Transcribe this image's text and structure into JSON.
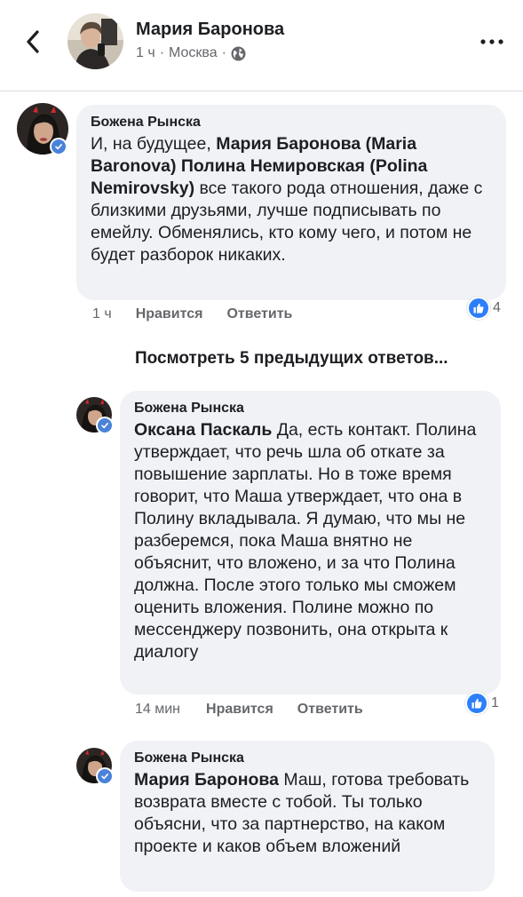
{
  "header": {
    "name": "Мария Баронова",
    "time": "1 ч",
    "separator": "·",
    "location": "Москва",
    "audience_icon": "globe-icon"
  },
  "comments": [
    {
      "author": "Божена Рынска",
      "segments": [
        {
          "t": "И, на будущее, ",
          "b": false
        },
        {
          "t": "Мария Баронова (Maria Baronova)",
          "b": true
        },
        {
          "t": " ",
          "b": false
        },
        {
          "t": "Полина Немировская (Polina Nemirovsky)",
          "b": true
        },
        {
          "t": " все такого рода отношения, даже с близкими друзьями, лучше подписывать по емейлу. Обменялись, кто кому чего, и потом не будет разборок никаких.",
          "b": false
        }
      ],
      "time": "1 ч",
      "like_label": "Нравится",
      "reply_label": "Ответить",
      "reaction_count": "4"
    },
    {
      "author": "Божена Рынска",
      "segments": [
        {
          "t": "Оксана Паскаль",
          "b": true
        },
        {
          "t": " Да, есть контакт. Полина утверждает, что речь шла об откате за повышение зарплаты. Но в тоже время говорит, что Маша утверждает, что она в Полину вкладывала. Я думаю, что мы не разберемся, пока Маша внятно не объяснит, что вложено, и за что Полина должна. После этого только мы сможем оценить вложения. Полине можно по мессенджеру позвонить, она открыта к диалогу",
          "b": false
        }
      ],
      "time": "14 мин",
      "like_label": "Нравится",
      "reply_label": "Ответить",
      "reaction_count": "1"
    },
    {
      "author": "Божена Рынска",
      "segments": [
        {
          "t": "Мария Баронова",
          "b": true
        },
        {
          "t": " Маш, готова требовать возврата вместе с тобой. Ты только объясни, что за партнерство, на каком проекте и каков объем вложений",
          "b": false
        }
      ]
    }
  ],
  "view_more": "Посмотреть 5 предыдущих ответов...",
  "colors": {
    "bubble": "#f0f2f5",
    "meta_text": "#65676b",
    "like_blue": "#2d7ff9",
    "verified_blue": "#4b82d9"
  }
}
